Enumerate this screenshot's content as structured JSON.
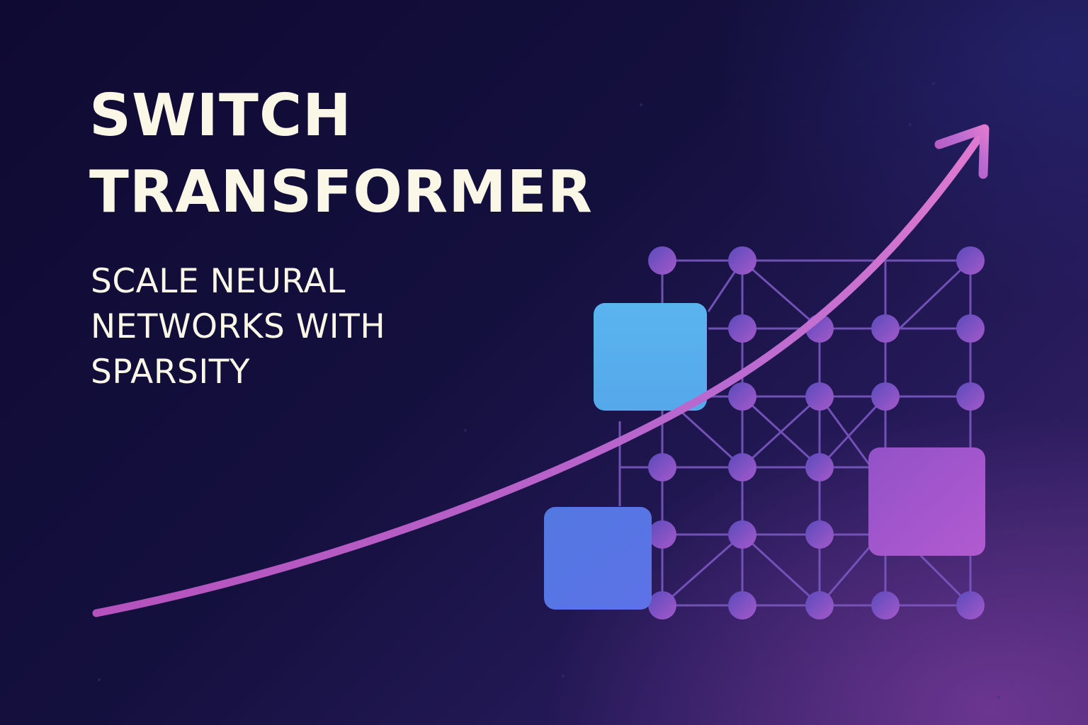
{
  "hero": {
    "title_lines": [
      "SWITCH",
      "TRANSFORMER"
    ],
    "subtitle_lines": [
      "SCALE NEURAL",
      "NETWORKS WITH",
      "SPARSITY"
    ]
  },
  "colors": {
    "text": "#fbf7e6",
    "background_dark": "#0f0a33",
    "background_light": "#3a2468",
    "node": "#7a55c8",
    "edge": "#7f5cc4",
    "arrow_start": "#c65fc2",
    "arrow_end": "#e07ad0",
    "expert_block_top": "#56b0ec",
    "expert_block_bottom_left": "#5878e6",
    "expert_block_right": "#a052cc"
  },
  "illustration": {
    "icon": "growth-arrow-icon",
    "network": "sparse-network-grid",
    "expert_blocks": 3
  }
}
